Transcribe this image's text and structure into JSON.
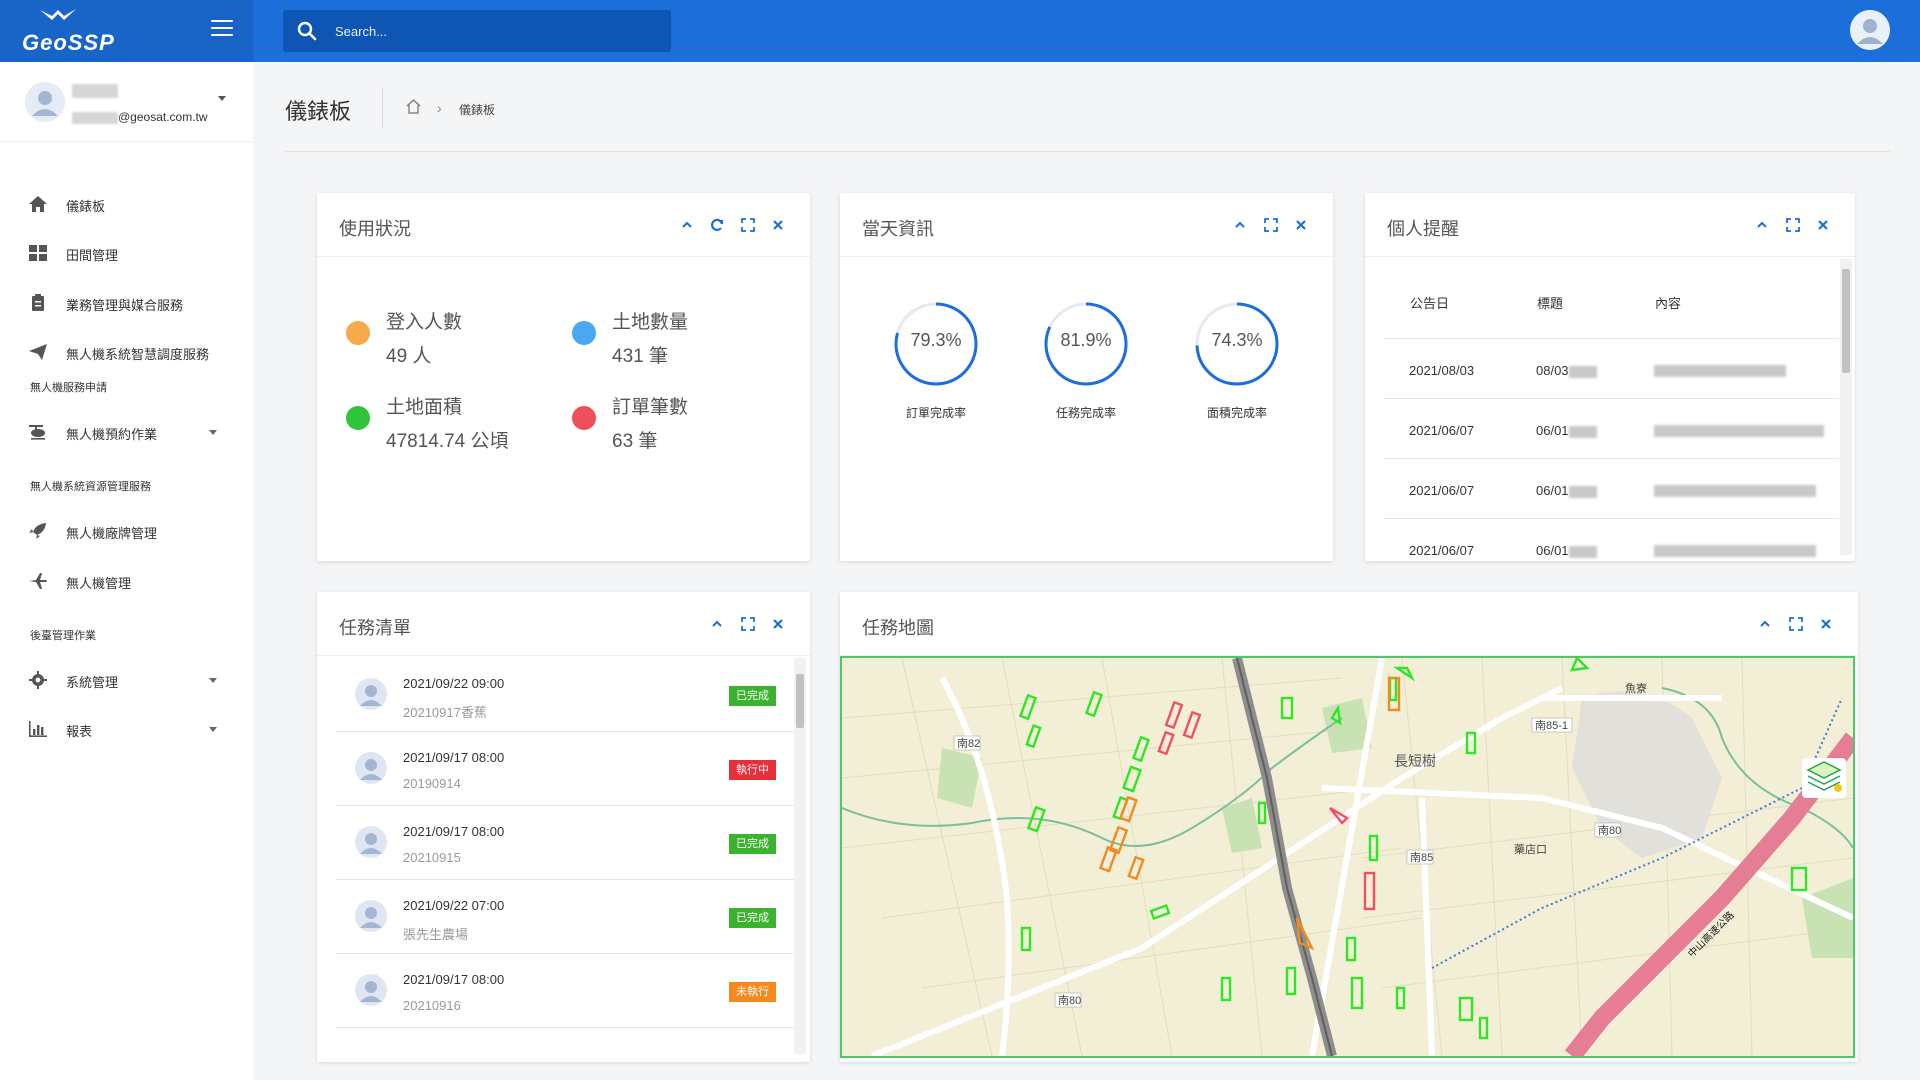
{
  "app": {
    "logo": "GeoSSP"
  },
  "search": {
    "placeholder": "Search..."
  },
  "user": {
    "email_domain": "@geosat.com.tw"
  },
  "sidebar": {
    "items": [
      {
        "label": "儀錶板",
        "icon": "home-icon"
      },
      {
        "label": "田間管理",
        "icon": "grid-icon"
      },
      {
        "label": "業務管理與媒合服務",
        "icon": "clipboard-icon"
      },
      {
        "label": "無人機系統智慧調度服務",
        "icon": "paper-plane-icon"
      }
    ],
    "section1": "無人機服務申請",
    "item_booking": {
      "label": "無人機預約作業",
      "icon": "helicopter-icon"
    },
    "section2": "無人機系統資源管理服務",
    "item_brand": {
      "label": "無人機廠牌管理",
      "icon": "rocket-icon"
    },
    "item_drone": {
      "label": "無人機管理",
      "icon": "plane-icon"
    },
    "section3": "後臺管理作業",
    "item_system": {
      "label": "系統管理",
      "icon": "gear-icon"
    },
    "item_report": {
      "label": "報表",
      "icon": "bar-chart-icon"
    }
  },
  "page": {
    "title": "儀錶板",
    "breadcrumb": "儀錶板"
  },
  "usage": {
    "title": "使用狀況",
    "stats": [
      {
        "label": "登入人數",
        "value": "49 人",
        "color": "#f7a94b"
      },
      {
        "label": "土地數量",
        "value": "431 筆",
        "color": "#4aa8f0"
      },
      {
        "label": "土地面積",
        "value": "47814.74 公頃",
        "color": "#2fc43c"
      },
      {
        "label": "訂單筆數",
        "value": "63 筆",
        "color": "#ef4f5b"
      }
    ]
  },
  "today": {
    "title": "當天資訊",
    "rings": [
      {
        "value": "79.3%",
        "label": "訂單完成率",
        "percent": 79.3
      },
      {
        "value": "81.9%",
        "label": "任務完成率",
        "percent": 81.9
      },
      {
        "value": "74.3%",
        "label": "面積完成率",
        "percent": 74.3
      }
    ]
  },
  "reminders": {
    "title": "個人提醒",
    "headers": [
      "公告日",
      "標題",
      "內容"
    ],
    "rows": [
      {
        "date": "2021/08/03",
        "title": "08/03"
      },
      {
        "date": "2021/06/07",
        "title": "06/01"
      },
      {
        "date": "2021/06/07",
        "title": "06/01"
      },
      {
        "date": "2021/06/07",
        "title": "06/01"
      }
    ]
  },
  "tasks": {
    "title": "任務清單",
    "items": [
      {
        "datetime": "2021/09/22 09:00",
        "name": "20210917香蕉",
        "status": "已完成",
        "color": "#3bb32f"
      },
      {
        "datetime": "2021/09/17 08:00",
        "name": "20190914",
        "status": "執行中",
        "color": "#e82f3c"
      },
      {
        "datetime": "2021/09/17 08:00",
        "name": "20210915",
        "status": "已完成",
        "color": "#3bb32f"
      },
      {
        "datetime": "2021/09/22 07:00",
        "name": "張先生農場",
        "status": "已完成",
        "color": "#3bb32f"
      },
      {
        "datetime": "2021/09/17 08:00",
        "name": "20210916",
        "status": "未執行",
        "color": "#f58a1f"
      }
    ]
  },
  "map": {
    "title": "任務地圖",
    "labels": {
      "nan82": "南82",
      "nan85_1": "南85-1",
      "changduanshu": "長短樹",
      "nan80a": "南80",
      "nan85": "南85",
      "yaodiankou": "藥店口",
      "nan80b": "南80",
      "yuliao": "魚寮",
      "zhongshan": "中山高速公路"
    }
  },
  "colors": {
    "accent": "#1c6fd8",
    "brand": "#1965c7",
    "icon_blue": "#1c6fd8"
  }
}
